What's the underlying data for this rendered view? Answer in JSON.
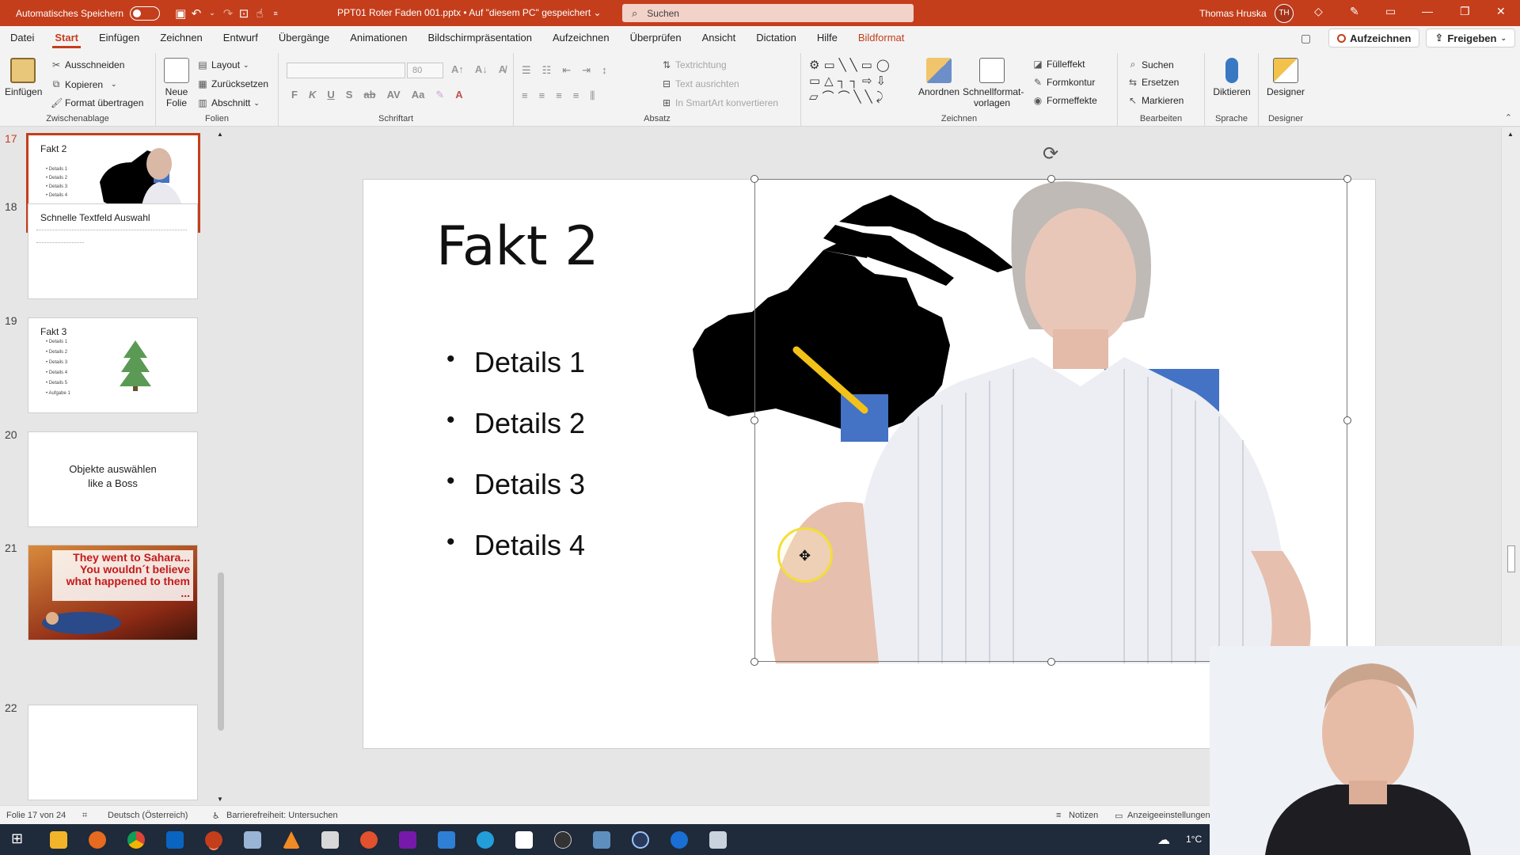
{
  "titlebar": {
    "autosave_label": "Automatisches Speichern",
    "document_title": "PPT01 Roter Faden 001.pptx • Auf \"diesem PC\" gespeichert ⌄",
    "search_placeholder": "Suchen",
    "user_name": "Thomas Hruska",
    "user_initials": "TH"
  },
  "menu": {
    "tabs": [
      "Datei",
      "Start",
      "Einfügen",
      "Zeichnen",
      "Entwurf",
      "Übergänge",
      "Animationen",
      "Bildschirmpräsentation",
      "Aufzeichnen",
      "Überprüfen",
      "Ansicht",
      "Dictation",
      "Hilfe",
      "Bildformat"
    ],
    "active_tab": "Start",
    "record_button": "Aufzeichnen",
    "share_button": "Freigeben"
  },
  "ribbon": {
    "clipboard": {
      "label": "Zwischenablage",
      "paste": "Einfügen",
      "cut": "Ausschneiden",
      "copy": "Kopieren",
      "format_painter": "Format übertragen"
    },
    "slides": {
      "label": "Folien",
      "new_slide": "Neue Folie",
      "layout": "Layout",
      "reset": "Zurücksetzen",
      "section": "Abschnitt"
    },
    "font": {
      "label": "Schriftart",
      "size": "80"
    },
    "paragraph": {
      "label": "Absatz",
      "text_direction": "Textrichtung",
      "align_text": "Text ausrichten",
      "smartart": "In SmartArt konvertieren"
    },
    "drawing": {
      "label": "Zeichnen",
      "arrange": "Anordnen",
      "quick_styles": "Schnellformat-vorlagen",
      "shape_fill": "Fülleffekt",
      "shape_outline": "Formkontur",
      "shape_effects": "Formeffekte"
    },
    "editing": {
      "label": "Bearbeiten",
      "find": "Suchen",
      "replace": "Ersetzen",
      "select": "Markieren"
    },
    "voice": {
      "label": "Sprache",
      "dictate": "Diktieren"
    },
    "designer": {
      "label": "Designer",
      "button": "Designer"
    }
  },
  "thumbnails": [
    {
      "number": "17",
      "title": "Fakt 2",
      "bullets": [
        "Details 1",
        "Details 2",
        "Details 3",
        "Details 4"
      ],
      "active": true
    },
    {
      "number": "18",
      "title": "Schnelle Textfeld Auswahl"
    },
    {
      "number": "19",
      "title": "Fakt 3",
      "bullets": [
        "Details 1",
        "Details 2",
        "Details 3",
        "Details 4",
        "Details 5",
        "Aufgabe 1"
      ]
    },
    {
      "number": "20",
      "center_line1": "Objekte auswählen",
      "center_line2": "like a Boss"
    },
    {
      "number": "21",
      "banner_text": "They went to Sahara... You wouldn´t believe what happened to them ..."
    },
    {
      "number": "22"
    }
  ],
  "slide": {
    "title": "Fakt 2",
    "bullets": [
      "Details 1",
      "Details 2",
      "Details 3",
      "Details 4"
    ]
  },
  "statusbar": {
    "slide_count": "Folie 17 von 24",
    "language": "Deutsch (Österreich)",
    "accessibility": "Barrierefreiheit: Untersuchen",
    "notes": "Notizen",
    "display_settings": "Anzeigeeinstellungen"
  },
  "taskbar": {
    "temperature": "1°C"
  },
  "colors": {
    "accent": "#c43e1c",
    "selection_blue": "#4472c4",
    "map_black": "#000000",
    "arrow_yellow": "#f2c218"
  }
}
